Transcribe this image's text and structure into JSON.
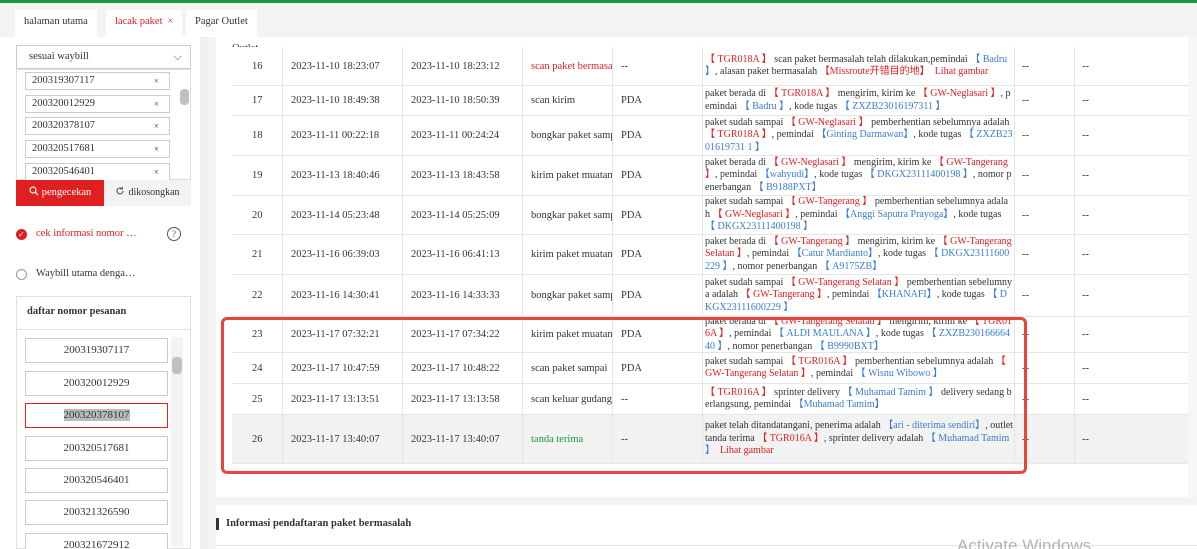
{
  "tabs": [
    {
      "label": "halaman utama"
    },
    {
      "label": "lacak paket",
      "close": "×"
    },
    {
      "label": "Pagar Outlet"
    }
  ],
  "sidebar": {
    "select_value": "sesuai waybill",
    "select_chevron": "⌵",
    "waybills": [
      "200319307117",
      "200320012929",
      "200320378107",
      "200320517681",
      "200320546401"
    ],
    "remove_glyph": "×",
    "search_label": "pengecekan",
    "search_icon": "search-icon",
    "clear_label": "dikosongkan",
    "clear_icon": "refresh-icon",
    "option1_label": "cek informasi nomor …",
    "option2_label": "Waybill utama denga…",
    "help_glyph": "?",
    "list_title": "daftar nomor pesanan",
    "orders": [
      "200319307117",
      "200320012929",
      "200320378107",
      "200320517681",
      "200320546401",
      "200321326590",
      "200321672912"
    ],
    "selected_order": "200320378107"
  },
  "main": {
    "outlet_label": "Outlet",
    "rows": [
      {
        "no": "16",
        "t1": "2023-11-10 18:23:07",
        "t2": "2023-11-10 18:23:12",
        "type": "scan paket bermasalah",
        "device": "--",
        "desc_html": "<span class='red'>【 TGR018A 】</span> scan paket bermasalah telah dilakukan,pemindai <span class='blue'>【 Badru 】</span>, alasan paket bermasalah <span class='red'>【Missroute开错目的地】</span> &nbsp;<span class='red'>Lihat gambar</span>",
        "c1": "--",
        "c2": "--"
      },
      {
        "no": "17",
        "t1": "2023-11-10 18:49:38",
        "t2": "2023-11-10 18:50:39",
        "type": "scan kirim",
        "device": "PDA",
        "desc_html": "paket berada di <span class='red'>【 TGR018A 】</span> mengirim, kirim ke <span class='red'>【 GW-Neglasari 】</span>, pemindai <span class='blue'>【 Badru 】</span>, kode tugas <span class='blue'>【 ZXZB23016197311 】</span>",
        "c1": "--",
        "c2": "--"
      },
      {
        "no": "18",
        "t1": "2023-11-11 00:22:18",
        "t2": "2023-11-11 00:24:24",
        "type": "bongkar paket sampai",
        "device": "PDA",
        "desc_html": "paket sudah sampai <span class='red'>【 GW-Neglasari 】</span> pemberhentian sebelumnya adalah <span class='red'>【 TGR018A 】</span>, pemindai <span class='blue'>【Ginting Darmawan】</span>, kode tugas <span class='blue'>【 ZXZB2301619731 1 】</span>",
        "c1": "--",
        "c2": "--"
      },
      {
        "no": "19",
        "t1": "2023-11-13 18:40:46",
        "t2": "2023-11-13 18:43:58",
        "type": "kirim paket muatan",
        "device": "PDA",
        "desc_html": "paket berada di <span class='red'>【 GW-Neglasari 】</span> mengirim, kirim ke <span class='red'>【 GW-Tangerang 】</span>, pemindai <span class='blue'>【wahyudi】</span>, kode tugas <span class='blue'>【 DKGX23111400198 】</span>, nomor penerbangan <span class='blue'>【 B9188PXT】</span>",
        "c1": "--",
        "c2": "--"
      },
      {
        "no": "20",
        "t1": "2023-11-14 05:23:48",
        "t2": "2023-11-14 05:25:09",
        "type": "bongkar paket sampai",
        "device": "PDA",
        "desc_html": "paket sudah sampai <span class='red'>【 GW-Tangerang 】</span> pemberhentian sebelumnya adalah <span class='red'>【 GW-Neglasari 】</span>, pemindai <span class='blue'>【Anggi Saputra Prayoga】</span>, kode tugas <span class='blue'>【 DKGX23111400198 】</span>",
        "c1": "--",
        "c2": "--"
      },
      {
        "no": "21",
        "t1": "2023-11-16 06:39:03",
        "t2": "2023-11-16 06:41:13",
        "type": "kirim paket muatan",
        "device": "PDA",
        "desc_html": "paket berada di <span class='red'>【 GW-Tangerang 】</span> mengirim, kirim ke <span class='red'>【 GW-Tangerang Selatan 】</span>, pemindai <span class='blue'>【Catur Mardianto】</span>, kode tugas <span class='blue'>【 DKGX23111600229 】</span>, nomor penerbangan <span class='blue'>【 A9175ZB】</span>",
        "c1": "--",
        "c2": "--"
      },
      {
        "no": "22",
        "t1": "2023-11-16 14:30:41",
        "t2": "2023-11-16 14:33:33",
        "type": "bongkar paket sampai",
        "device": "PDA",
        "desc_html": "paket sudah sampai <span class='red'>【 GW-Tangerang Selatan 】</span> pemberhentian sebelumnya adalah <span class='red'>【 GW-Tangerang 】</span>, pemindai <span class='blue'>【KHANAFI】</span>, kode tugas <span class='blue'>【 DKGX23111600229 】</span>",
        "c1": "--",
        "c2": "--"
      },
      {
        "no": "23",
        "t1": "2023-11-17 07:32:21",
        "t2": "2023-11-17 07:34:22",
        "type": "kirim paket muatan",
        "device": "PDA",
        "desc_html": "paket berada di <span class='red'>【 GW-Tangerang Selatan 】</span> mengirim, kirim ke <span class='red'>【 TGR016A 】</span>, pemindai <span class='blue'>【 ALDI MAULANA 】</span>, kode tugas <span class='blue'>【 ZXZB23016666440 】</span>, nomor penerbangan <span class='blue'>【 B9990BXT】</span>",
        "c1": "--",
        "c2": "--"
      },
      {
        "no": "24",
        "t1": "2023-11-17 10:47:59",
        "t2": "2023-11-17 10:48:22",
        "type": "scan paket sampai",
        "device": "PDA",
        "desc_html": "paket sudah sampai <span class='red'>【 TGR016A 】</span> pemberhentian sebelumnya adalah <span class='red'>【 GW-Tangerang Selatan 】</span>, pemindai <span class='blue'>【 Wisnu Wibowo 】</span>",
        "c1": "--",
        "c2": "--"
      },
      {
        "no": "25",
        "t1": "2023-11-17 13:13:51",
        "t2": "2023-11-17 13:13:58",
        "type": "scan keluar gudang",
        "device": "--",
        "desc_html": "<span class='red'>【 TGR016A 】</span> sprinter delivery <span class='blue'>【 Muhamad Tamim 】</span> delivery sedang berlangsung, pemindai <span class='blue'>【Muhamad Tamim】</span>",
        "c1": "--",
        "c2": "--"
      },
      {
        "no": "26",
        "t1": "2023-11-17 13:40:07",
        "t2": "2023-11-17 13:40:07",
        "type": "tanda terima",
        "device": "--",
        "desc_html": "paket telah ditandatangani, penerima adalah <span class='blue'>【ari - diterima sendiri】</span>, outlet tanda terima <span class='red'>【 TGR016A 】</span>, sprinter delivery adalah <span class='blue'>【 Muhamad Tamim 】</span> &nbsp;<span class='red'>Lihat gambar</span>",
        "c1": "--",
        "c2": "--"
      }
    ],
    "section2_title": "Informasi pendaftaran paket bermasalah"
  },
  "os_watermark": "Activate Windows",
  "colors": {
    "accent": "#e02020",
    "link": "#3a7bd5",
    "success": "#1a9a3c",
    "highlight": "#e8463a"
  }
}
